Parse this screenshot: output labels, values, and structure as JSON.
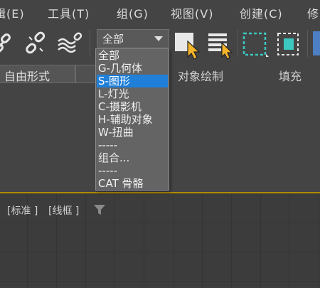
{
  "menubar": {
    "items": [
      "辑(E)",
      "工具(T)",
      "组(G)",
      "视图(V)",
      "创建(C)",
      "修"
    ]
  },
  "toolbar": {
    "selection_filter": {
      "value": "全部",
      "options": [
        "全部",
        "G-几何体",
        "S-图形",
        "L-灯光",
        "C-摄影机",
        "H-辅助对象",
        "W-扭曲",
        "-----",
        "组合...",
        "-----",
        "CAT 骨骼"
      ],
      "highlighted": "S-图形"
    }
  },
  "ribbon": {
    "tabs": [
      "自由形式",
      "对象绘制",
      "填充"
    ]
  },
  "viewport": {
    "label_standard": "[标准 ]",
    "label_wireframe": "[线框 ]"
  },
  "colors": {
    "highlight": "#1f7fd9",
    "accent_icon": "#3cc8c0",
    "cursor_yellow": "#f5b52a",
    "viewport_border": "#b08a00"
  }
}
